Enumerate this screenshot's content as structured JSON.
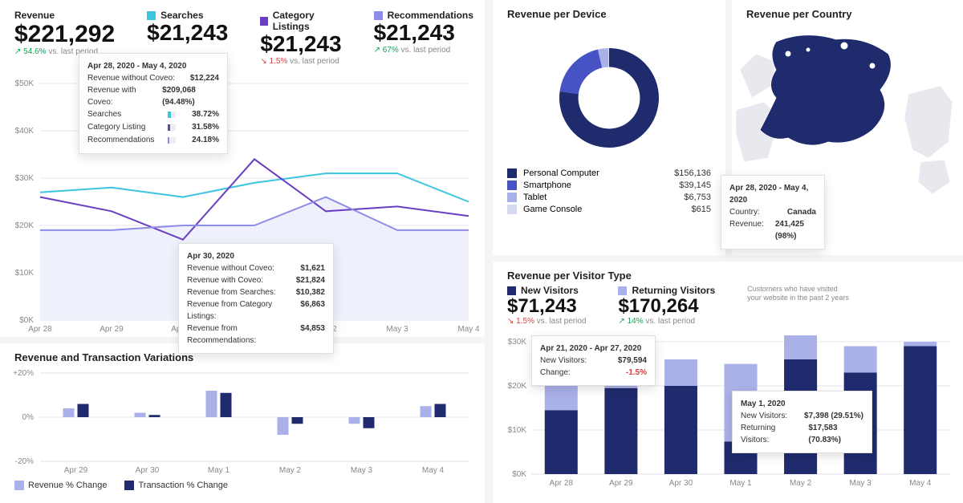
{
  "colors": {
    "searches": "#3cc4e0",
    "catlist": "#6a3fc3",
    "recs": "#8e8ce8",
    "navy": "#1f2b6d",
    "mid": "#4753c4",
    "light": "#aab0e8",
    "pale": "#d6d9f2"
  },
  "revenue": {
    "title": "Revenue",
    "total": "$221,292",
    "delta_val": "54.6%",
    "delta_sfx": "vs. last period",
    "delta_dir": "up",
    "kpis": [
      {
        "label": "Searches",
        "value": "$21,243",
        "delta": "",
        "dir": "",
        "color": "#3cc4e0"
      },
      {
        "label": "Category Listings",
        "value": "$21,243",
        "delta": "1.5%",
        "dir": "down",
        "color": "#6a3fc3"
      },
      {
        "label": "Recommendations",
        "value": "$21,243",
        "delta": "67%",
        "dir": "up",
        "color": "#8e8ce8"
      }
    ],
    "tooltip1": {
      "range": "Apr 28, 2020 - May 4, 2020",
      "rows": [
        [
          "Revenue without Coveo:",
          "$12,224"
        ],
        [
          "Revenue with Coveo:",
          "$209,068 (94.48%)"
        ]
      ],
      "bars": [
        {
          "name": "Searches",
          "pct": "38.72%",
          "color": "#3cc4e0"
        },
        {
          "name": "Category Listing",
          "pct": "31.58%",
          "color": "#6a3fc3"
        },
        {
          "name": "Recommendations",
          "pct": "24.18%",
          "color": "#8e8ce8"
        }
      ]
    },
    "tooltip2": {
      "date": "Apr 30, 2020",
      "rows": [
        [
          "Revenue without Coveo:",
          "$1,621"
        ],
        [
          "Revenue with Coveo:",
          "$21,824"
        ],
        [
          "Revenue from Searches:",
          "$10,382"
        ],
        [
          "Revenue from Category Listings:",
          "$6,863"
        ],
        [
          "Revenue from Recommendations:",
          "$4,853"
        ]
      ]
    }
  },
  "variations": {
    "title": "Revenue and Transaction Variations",
    "legend": [
      {
        "label": "Revenue % Change",
        "color": "#aab0e8"
      },
      {
        "label": "Transaction % Change",
        "color": "#1f2b6d"
      }
    ]
  },
  "device": {
    "title": "Revenue per Device",
    "rows": [
      {
        "name": "Personal Computer",
        "value": "$156,136",
        "color": "#1f2b6d"
      },
      {
        "name": "Smartphone",
        "value": "$39,145",
        "color": "#4753c4"
      },
      {
        "name": "Tablet",
        "value": "$6,753",
        "color": "#aab0e8"
      },
      {
        "name": "Game Console",
        "value": "$615",
        "color": "#d6d9f2"
      }
    ]
  },
  "country": {
    "title": "Revenue per Country",
    "tooltip": {
      "range": "Apr 28, 2020 - May 4, 2020",
      "rows": [
        [
          "Country:",
          "Canada"
        ],
        [
          "Revenue:",
          "241,425 (98%)"
        ]
      ]
    }
  },
  "visitor": {
    "title": "Revenue per Visitor Type",
    "kpis": [
      {
        "label": "New Visitors",
        "value": "$71,243",
        "delta": "1.5%",
        "dir": "down",
        "color": "#1f2b6d"
      },
      {
        "label": "Returning Visitors",
        "value": "$170,264",
        "delta": "14%",
        "dir": "up",
        "color": "#aab0e8"
      }
    ],
    "hint": "Customers who have visited your website in the past 2 years",
    "tooltip1": {
      "range": "Apr 21, 2020 - Apr 27, 2020",
      "rows": [
        [
          "New Visitors:",
          "$79,594"
        ],
        [
          "Change:",
          "-1.5%"
        ]
      ]
    },
    "tooltip2": {
      "date": "May 1, 2020",
      "rows": [
        [
          "New Visitors:",
          "$7,398 (29.51%)"
        ],
        [
          "Returning Visitors:",
          "$17,583 (70.83%)"
        ]
      ]
    }
  },
  "chart_data": [
    {
      "type": "line",
      "id": "revenue_trend",
      "x": [
        "Apr 28",
        "Apr 29",
        "Apr 30",
        "May 1",
        "May 2",
        "May 3",
        "May 4"
      ],
      "series": [
        {
          "name": "Searches",
          "color": "#3cc4e0",
          "values": [
            27000,
            28000,
            26000,
            29000,
            31000,
            31000,
            25000
          ]
        },
        {
          "name": "Category Listings",
          "color": "#6a3fc3",
          "values": [
            26000,
            23000,
            17000,
            34000,
            23000,
            24000,
            22000
          ]
        },
        {
          "name": "Recommendations",
          "color": "#8e8ce8",
          "values": [
            19000,
            19000,
            20000,
            20000,
            26000,
            19000,
            19000
          ]
        }
      ],
      "ylim": [
        0,
        50000
      ],
      "gridlines": [
        0,
        10000,
        20000,
        30000,
        40000,
        50000
      ],
      "y_tick_labels": [
        "$0K",
        "$10K",
        "$20K",
        "$30K",
        "$40K",
        "$50K"
      ]
    },
    {
      "type": "bar",
      "id": "variations",
      "x": [
        "Apr 29",
        "Apr 30",
        "May 1",
        "May 2",
        "May 3",
        "May 4"
      ],
      "series": [
        {
          "name": "Revenue % Change",
          "color": "#aab0e8",
          "values": [
            4,
            2,
            12,
            -8,
            -3,
            5
          ]
        },
        {
          "name": "Transaction % Change",
          "color": "#1f2b6d",
          "values": [
            6,
            1,
            11,
            -3,
            -5,
            6
          ]
        }
      ],
      "ylim": [
        -20,
        20
      ],
      "y_tick_labels": [
        "-20%",
        "0%",
        "+20%"
      ]
    },
    {
      "type": "pie",
      "id": "device_donut",
      "hole": 0.62,
      "labels": [
        "Personal Computer",
        "Smartphone",
        "Tablet",
        "Game Console"
      ],
      "values": [
        156136,
        39145,
        6753,
        615
      ],
      "colors": [
        "#1f2b6d",
        "#4753c4",
        "#aab0e8",
        "#d6d9f2"
      ]
    },
    {
      "type": "bar",
      "id": "visitor_stacked",
      "stacked": true,
      "x": [
        "Apr 28",
        "Apr 29",
        "Apr 30",
        "May 1",
        "May 2",
        "May 3",
        "May 4"
      ],
      "series": [
        {
          "name": "New Visitors",
          "color": "#1f2b6d",
          "values": [
            14500,
            19500,
            20000,
            7398,
            26000,
            23000,
            29000
          ]
        },
        {
          "name": "Returning Visitors",
          "color": "#aab0e8",
          "values": [
            9500,
            6500,
            6000,
            17583,
            6000,
            6000,
            1000
          ]
        }
      ],
      "ylim": [
        0,
        30000
      ],
      "y_tick_labels": [
        "$0K",
        "$10K",
        "$20K",
        "$30K"
      ]
    }
  ]
}
